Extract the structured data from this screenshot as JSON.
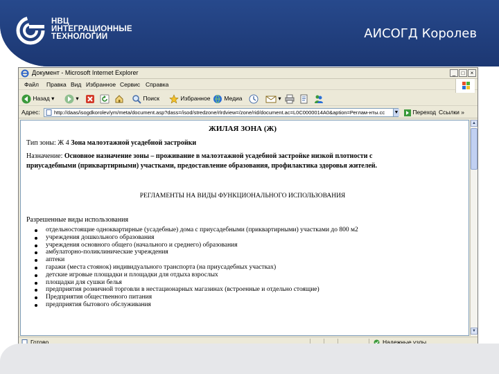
{
  "slide": {
    "logo_lines": [
      "НВЦ",
      "ИНТЕГРАЦИОННЫЕ",
      "ТЕХНОЛОГИИ"
    ],
    "title": "АИСОГД Королев"
  },
  "browser": {
    "window_title": "Документ - Microsoft Internet Explorer",
    "menu": [
      "Файл",
      "Правка",
      "Вид",
      "Избранное",
      "Сервис",
      "Справка"
    ],
    "toolbar": {
      "back": "Назад",
      "search": "Поиск",
      "favorites": "Избранное",
      "media": "Медиа"
    },
    "address_label": "Адрес:",
    "address_value": "http://daas/isogdkorolev/ym/meta/document.asp?dass=/isod/stredzone/rlrdview=/zone/rid/document.ac=L0C0000014A0&aption=Реглам-нты.сс",
    "go_label": "Переход",
    "links_label": "Ссылки",
    "status_text": "Готово",
    "zone_text": "Надежные узлы",
    "accent": "#1f3d7a"
  },
  "document": {
    "title": "ЖИЛАЯ ЗОНА (Ж)",
    "zone_type_label": "Тип зоны: Ж 4",
    "zone_type_value": "Зона малоэтажной усадебной застройки",
    "purpose_label": "Назначение:",
    "purpose_line1": "Основное назначение зоны – проживание в малоэтажной усадебной застройке низкой плотности с",
    "purpose_line2": "приусадебными (приквартирными) участками, предоставление образования, профилактика здоровья жителей.",
    "section_title": "РЕГЛАМЕНТЫ НА ВИДЫ ФУНКЦИОНАЛЬНОГО ИСПОЛЬЗОВАНИЯ",
    "allowed_title": "Разрешенные виды использования",
    "allowed_uses": [
      "отдельностоящие одноквартирные (усадебные) дома с приусадебными (приквартирными) участками до 800 м2",
      "учреждения дошкольного образования",
      "учреждения основного общего (начального и среднего) образования",
      "амбулаторно-поликлинические учреждения",
      "аптеки",
      "гаражи (места стоянок) индивидуального транспорта (на приусадебных участках)",
      "детские игровые площадки и площадки для отдыха взрослых",
      "площадки для сушки белья",
      "предприятия розничной торговли в нестационарных магазинах (встроенные и отдельно стоящие)",
      "Предприятия общественного питания",
      "предприятия бытового обслуживания"
    ]
  }
}
